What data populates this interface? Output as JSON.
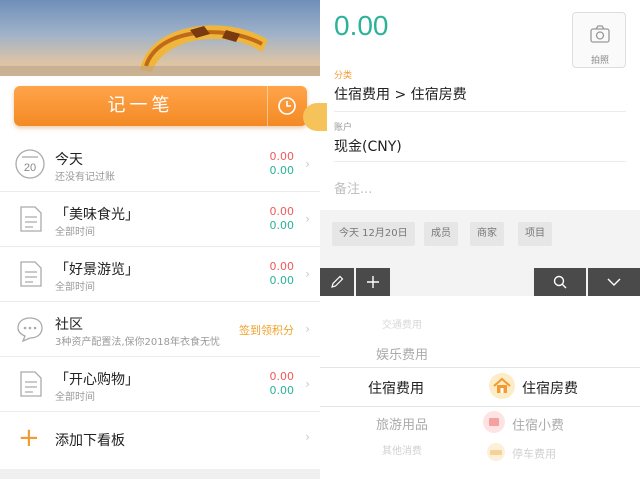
{
  "left": {
    "record_label": "记一笔",
    "rows": [
      {
        "title": "今天",
        "sub": "还没有记过账",
        "income": "0.00",
        "expense": "0.00",
        "date_num": "20"
      },
      {
        "title": "「美味食光」",
        "sub": "全部时间",
        "income": "0.00",
        "expense": "0.00"
      },
      {
        "title": "「好景游览」",
        "sub": "全部时间",
        "income": "0.00",
        "expense": "0.00"
      },
      {
        "title": "社区",
        "sub": "3种资产配置法,保你2018年衣食无忧",
        "promo": "签到领积分"
      },
      {
        "title": "「开心购物」",
        "sub": "全部时间",
        "income": "0.00",
        "expense": "0.00"
      }
    ],
    "add_board": "添加下看板"
  },
  "right": {
    "amount": "0.00",
    "photo_label": "拍照",
    "category_label": "分类",
    "category_value": "住宿费用 > 住宿房费",
    "account_label": "账户",
    "account_value": "现金(CNY)",
    "memo_placeholder": "备注...",
    "chips": [
      "今天 12月20日",
      "成员",
      "商家",
      "项目"
    ],
    "picker_left": [
      "交通费用",
      "娱乐费用",
      "住宿费用",
      "旅游用品",
      "其他消费"
    ],
    "picker_right": [
      "住宿房费",
      "住宿小费",
      "停车费用"
    ]
  },
  "colors": {
    "accent": "#f39a30",
    "green": "#2bb39a",
    "red": "#ef5a5a"
  }
}
